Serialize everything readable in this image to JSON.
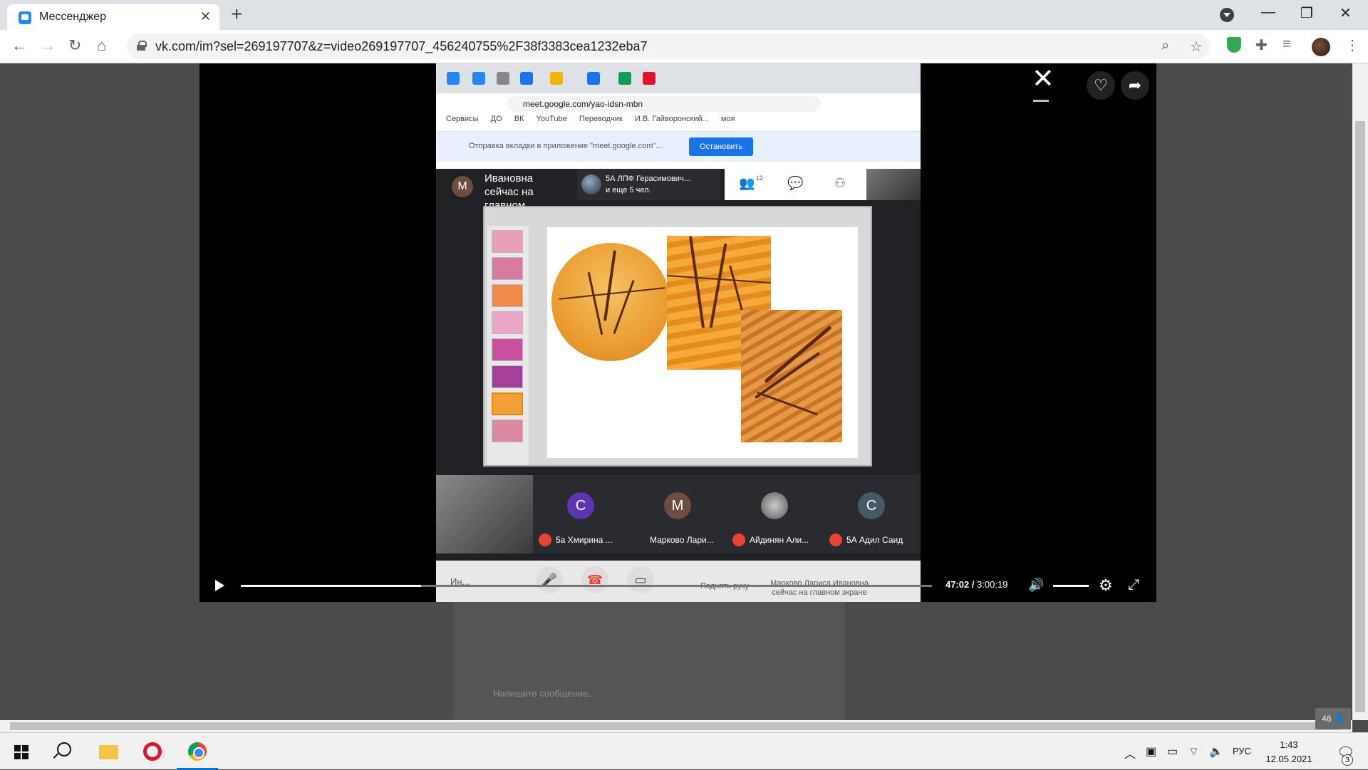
{
  "browser": {
    "tab_title": "Мессенджер",
    "url": "vk.com/im?sel=269197707&z=video269197707_456240755%2F38f3383cea1232eba7"
  },
  "meet": {
    "tabbar_label": "meet.google.com/yao-idsn-mbn",
    "bookmarks": [
      "Сервисы",
      "ДО",
      "ВК",
      "YouTube",
      "Переводчик",
      "И.В. Гайворонский...",
      "моя"
    ],
    "cast_text": "Отправка вкладки в приложение \"meet.google.com\"...",
    "cast_button": "Остановить",
    "presenter_initial": "М",
    "presenter_label": "Ивановна сейчас на главном",
    "meeting_name": "5А ЛПФ Герасимович...",
    "meeting_more": "и еще 5 чел.",
    "participant_count": "12",
    "participants": [
      {
        "initial": "С",
        "name": "5а Хмирина ...",
        "color": "#5e35b1"
      },
      {
        "initial": "М",
        "name": "Марково Лари...",
        "color": "#6d4c41"
      },
      {
        "initial": "",
        "name": "Айдинян Али...",
        "color": "#555555"
      },
      {
        "initial": "С",
        "name": "5А Адил Саид",
        "color": "#455a64"
      }
    ],
    "bottom_left": "Ин...",
    "raise_hand": "Поднять руку",
    "presenting_label": "Марково Лариса Ивановна сейчас на главном экране"
  },
  "player": {
    "current_time": "47:02",
    "duration": "3:00:19",
    "progress": 0.261
  },
  "page": {
    "message_placeholder": "Напишите сообщение...",
    "online_count": "46"
  },
  "taskbar": {
    "language": "РУС",
    "time": "1:43",
    "date": "12.05.2021",
    "notifications": "3"
  }
}
